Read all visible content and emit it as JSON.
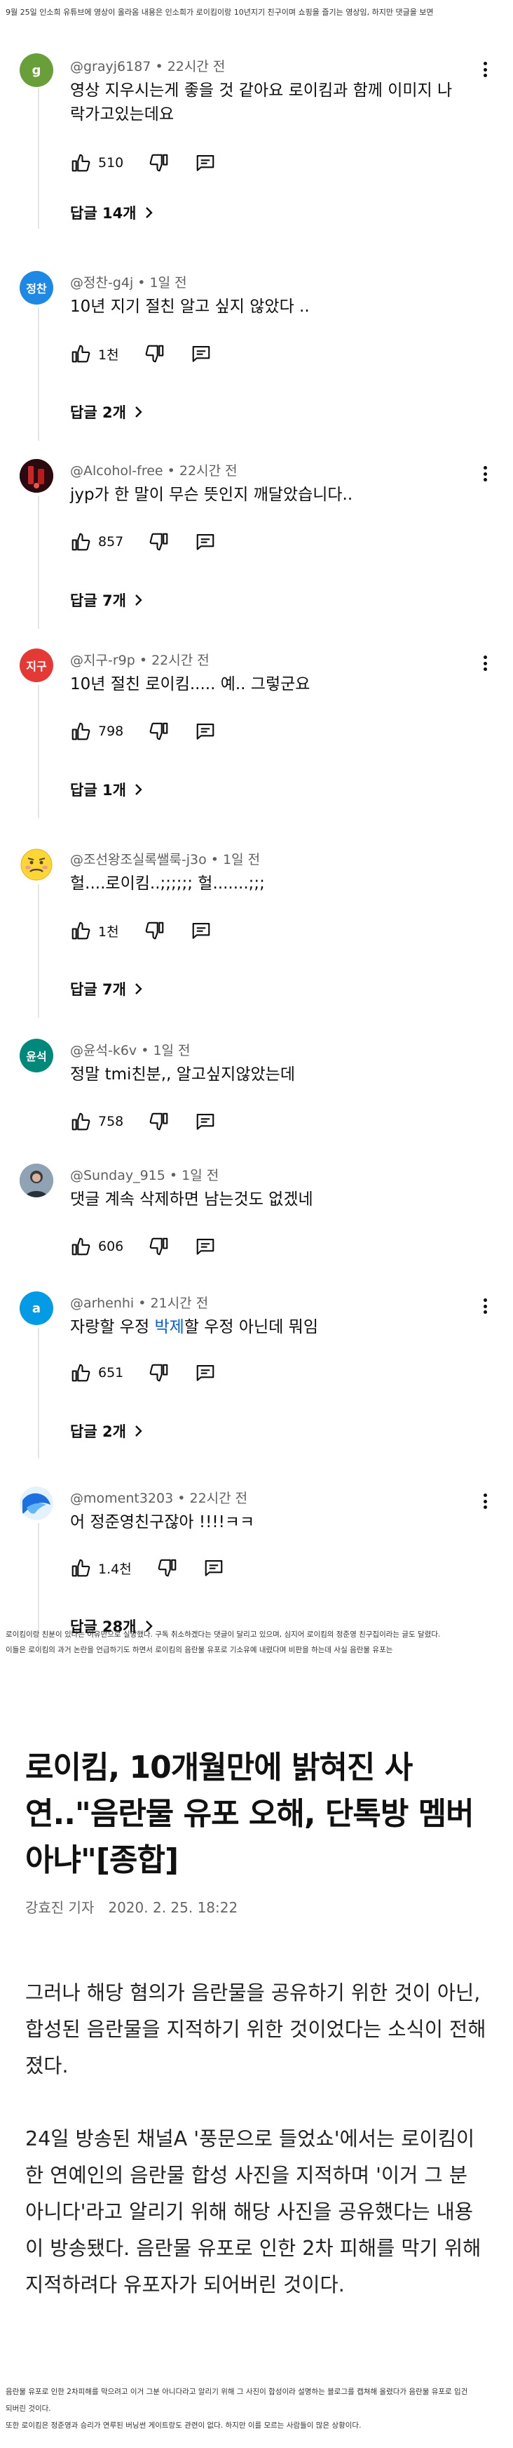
{
  "captions": {
    "top": "9월 25일 인소희 유튜브에 영상이 올라옴 내용은 인소희가 로이킴이랑 10년지기 친구이며 쇼핑을 즐기는 영상임, 하지만 댓글을 보면",
    "middle_1": "로이킴이랑 친분이 있다는 이유만으로 실망했다. 구독 취소하겠다는 댓글이 달리고 있으며, 심지어 로이킴의 정준영 친구집이라는 글도 달렸다.",
    "middle_2": "이들은 로이킴의 과거 논란을 언급하기도 하면서 로이킴의 음란물 유포로 기소유예 내렸다며 비판을 하는데 사실 음란물 유포는",
    "bottom_1": "음란물 유포로 인한 2차피해를 막으려고 이거 그분 아니다라고 알리기 위해 그 사진이 합성이라 설명하는 블로그를 캡쳐해 올렸다가 음란물 유포로 입건",
    "bottom_2": "되버린 것이다.",
    "bottom_3": "또한 로이킴은 정준영과 승리가 연루된 버닝썬 게이트랑도 관련이 없다. 하지만 이를 모르는 사람들이 많은 상황이다."
  },
  "comments": [
    {
      "handle": "@grayj6187",
      "time": "22시간 전",
      "text": "영상 지우시는게 좋을 것 같아요 로이킴과 함께 이미지 나락가고있는데요",
      "likes": "510",
      "replies": "답글 14개",
      "avatar_letter": "g",
      "avatar_color": "#689f38",
      "has_menu": true
    },
    {
      "handle": "@정찬-g4j",
      "time": "1일 전",
      "text": "10년 지기 절친 알고 싶지 않았다 ..",
      "likes": "1천",
      "replies": "답글 2개",
      "avatar_letter": "정찬",
      "avatar_color": "#1e88e5",
      "has_menu": false
    },
    {
      "handle": "@Alcohol-free",
      "time": "22시간 전",
      "text": "jyp가 한 말이 무슨 뜻인지 깨달았습니다..",
      "likes": "857",
      "replies": "답글 7개",
      "avatar_letter": "",
      "avatar_color": "#3a0d12",
      "has_menu": true
    },
    {
      "handle": "@지구-r9p",
      "time": "22시간 전",
      "text": "10년 절친 로이킴..... 예.. 그렇군요",
      "likes": "798",
      "replies": "답글 1개",
      "avatar_letter": "지구",
      "avatar_color": "#e53935",
      "has_menu": true
    },
    {
      "handle": "@조선왕조실록쌜룩-j3o",
      "time": "1일 전",
      "text": "헐....로이킴..;;;;;; 헐.......;;;",
      "likes": "1천",
      "replies": "답글 7개",
      "avatar_letter": "",
      "avatar_color": "#fde7c2",
      "has_menu": false
    },
    {
      "handle": "@윤석-k6v",
      "time": "1일 전",
      "text": "정말 tmi친분,, 알고싶지않았는데",
      "likes": "758",
      "replies": "",
      "avatar_letter": "윤석",
      "avatar_color": "#00897b",
      "has_menu": false
    },
    {
      "handle": "@Sunday_915",
      "time": "1일 전",
      "text": "댓글 계속 삭제하면 남는것도 없겠네",
      "likes": "606",
      "replies": "",
      "avatar_letter": "",
      "avatar_color": "#6a7b8c",
      "has_menu": false
    },
    {
      "handle": "@arhenhi",
      "time": "21시간 전",
      "text_before": "자랑할 우정 ",
      "text_link": "박제",
      "text_after": "할 우정 아닌데 뭐임",
      "likes": "651",
      "replies": "답글 2개",
      "avatar_letter": "a",
      "avatar_color": "#039be5",
      "has_menu": true
    },
    {
      "handle": "@moment3203",
      "time": "22시간 전",
      "text": "어 정준영친구잖아 !!!!ㅋㅋ",
      "likes": "1.4천",
      "replies": "답글 28개",
      "avatar_letter": "",
      "avatar_color": "#4a8fe8",
      "has_menu": true
    }
  ],
  "article": {
    "title": "로이킴, 10개월만에 밝혀진 사연..\"음란물 유포 오해, 단톡방 멤버 아냐\"[종합]",
    "reporter": "강효진 기자",
    "date": "2020. 2. 25. 18:22",
    "paragraph_1": "그러나 해당 혐의가 음란물을 공유하기 위한 것이 아닌, 합성된 음란물을 지적하기 위한 것이었다는 소식이 전해졌다.",
    "paragraph_2": "24일 방송된 채널A '풍문으로 들었쇼'에서는 로이킴이 한 연예인의 음란물 합성 사진을 지적하며 '이거 그 분 아니다'라고 알리기 위해 해당 사진을 공유했다는 내용이 방송됐다. 음란물 유포로 인한 2차 피해를 막기 위해 지적하려다 유포자가 되어버린 것이다."
  },
  "icons": {
    "like": "thumbs-up-icon",
    "dislike": "thumbs-down-icon",
    "reply": "comment-reply-icon",
    "menu": "more-vertical-icon",
    "chevron": "chevron-right-icon"
  }
}
